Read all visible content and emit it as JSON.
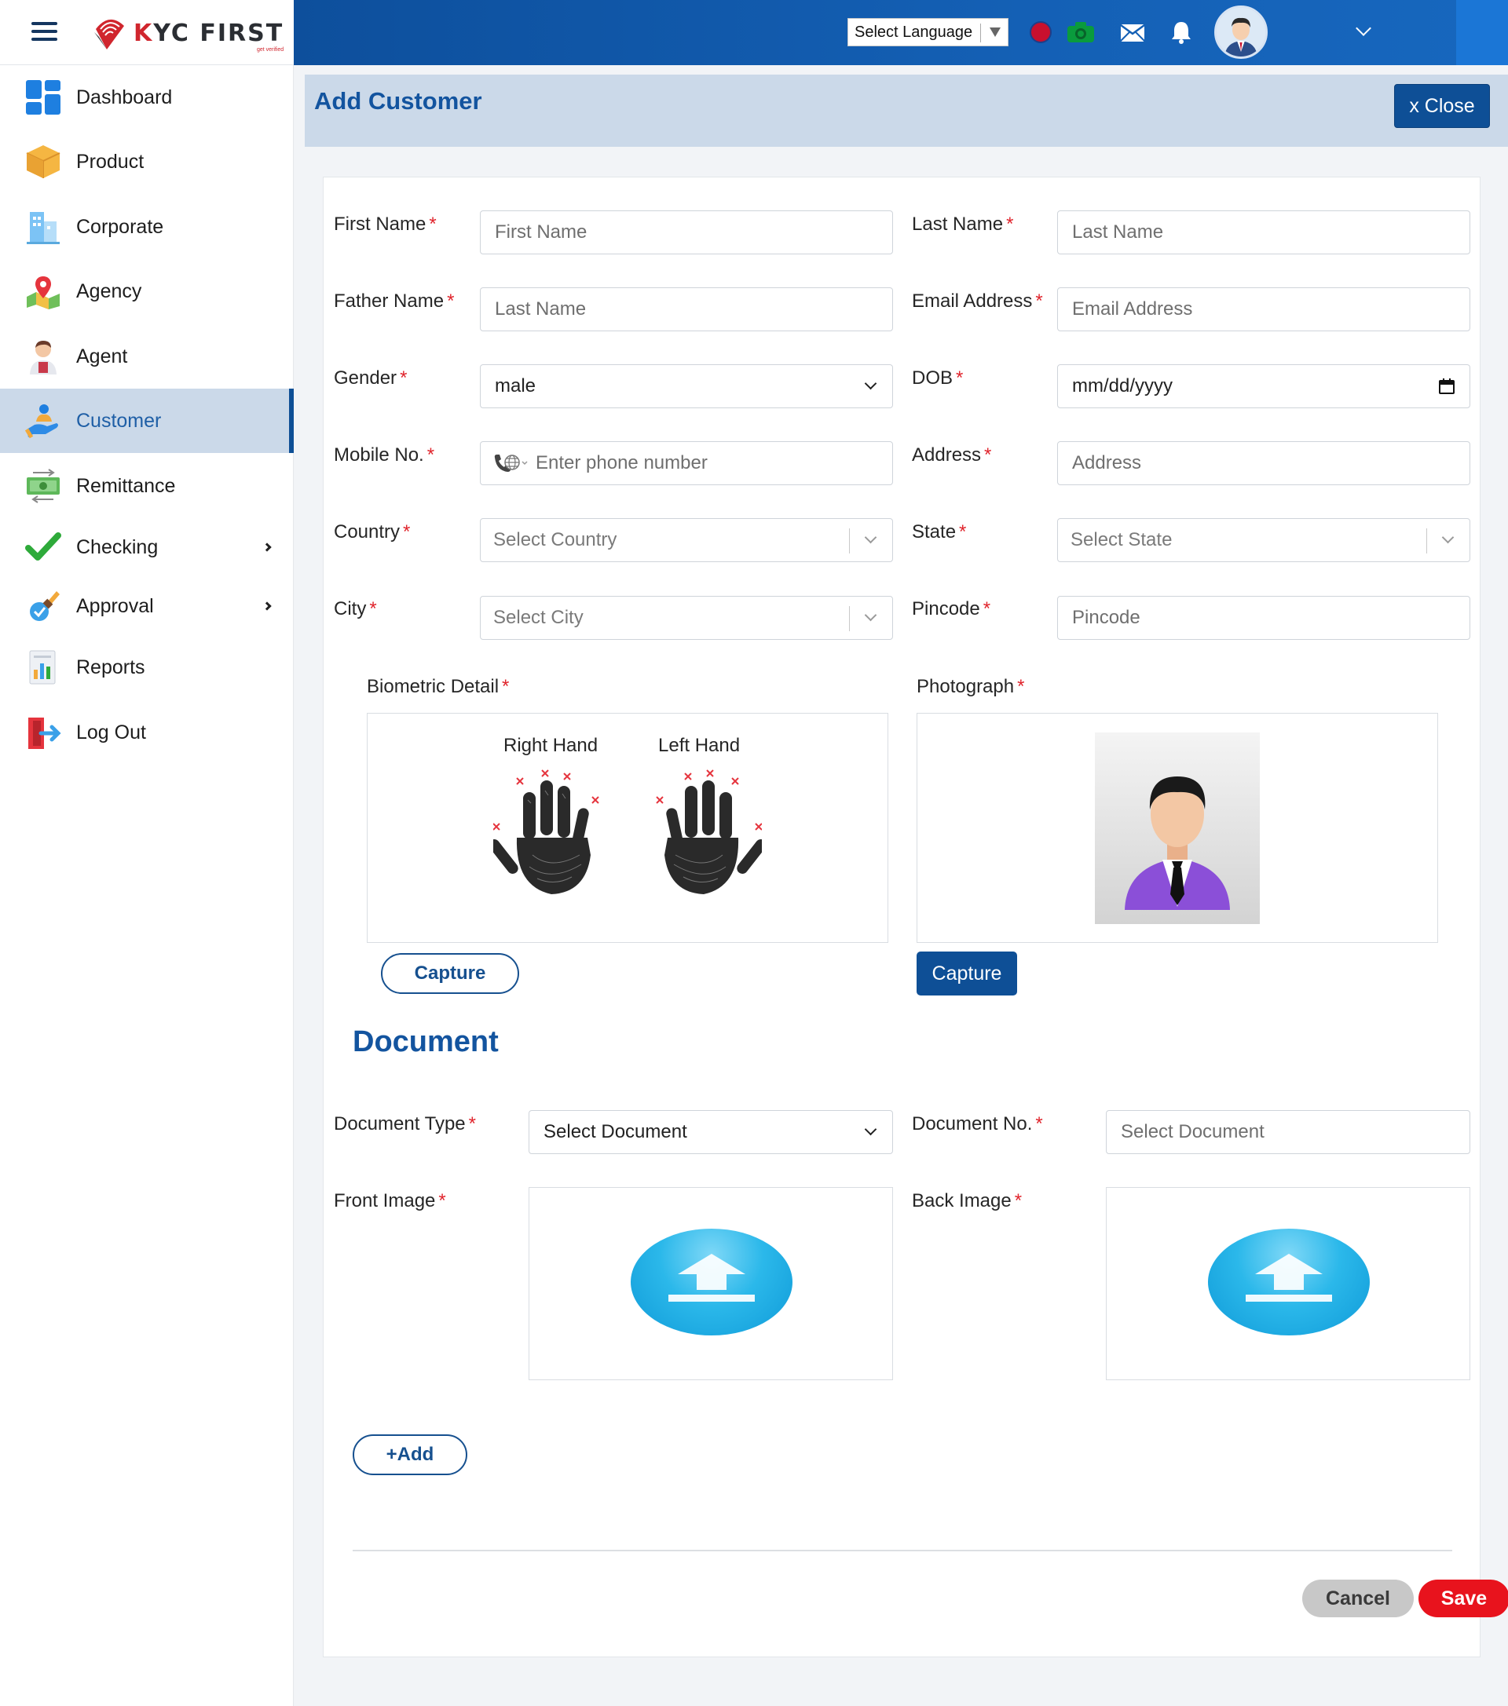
{
  "brand": {
    "name_prefix": "K",
    "name_rest": "YC FIRST",
    "tagline": "get verified"
  },
  "header": {
    "language_select": "Select Language",
    "colors": {
      "topbar": "#1460b5",
      "accent": "#0e4f96"
    }
  },
  "sidebar": {
    "items": [
      {
        "label": "Dashboard",
        "icon": "dashboard-icon"
      },
      {
        "label": "Product",
        "icon": "product-box-icon"
      },
      {
        "label": "Corporate",
        "icon": "corporate-building-icon"
      },
      {
        "label": "Agency",
        "icon": "agency-map-icon"
      },
      {
        "label": "Agent",
        "icon": "agent-person-icon"
      },
      {
        "label": "Customer",
        "icon": "customer-hand-icon",
        "active": true
      },
      {
        "label": "Remittance",
        "icon": "remittance-money-icon"
      },
      {
        "label": "Checking",
        "icon": "checkmark-icon",
        "submenu": true
      },
      {
        "label": "Approval",
        "icon": "approval-stamp-icon",
        "submenu": true
      },
      {
        "label": "Reports",
        "icon": "reports-chart-icon"
      },
      {
        "label": "Log Out",
        "icon": "logout-door-icon"
      }
    ]
  },
  "page": {
    "title": "Add Customer",
    "close_label": "x Close"
  },
  "form": {
    "first_name": {
      "label": "First Name",
      "placeholder": "First Name"
    },
    "last_name": {
      "label": "Last Name",
      "placeholder": "Last Name"
    },
    "father_name": {
      "label": "Father Name",
      "placeholder": "Last Name"
    },
    "email": {
      "label": "Email Address",
      "placeholder": "Email Address"
    },
    "gender": {
      "label": "Gender",
      "value": "male"
    },
    "dob": {
      "label": "DOB",
      "value": "mm/dd/yyyy"
    },
    "mobile": {
      "label": "Mobile No.",
      "placeholder": "Enter phone number"
    },
    "address": {
      "label": "Address",
      "placeholder": "Address"
    },
    "country": {
      "label": "Country",
      "placeholder": "Select Country"
    },
    "state": {
      "label": "State",
      "placeholder": "Select State"
    },
    "city": {
      "label": "City",
      "placeholder": "Select City"
    },
    "pincode": {
      "label": "Pincode",
      "placeholder": "Pincode"
    }
  },
  "biometric": {
    "label": "Biometric Detail",
    "right_hand": "Right Hand",
    "left_hand": "Left Hand",
    "capture_label": "Capture"
  },
  "photograph": {
    "label": "Photograph",
    "capture_label": "Capture"
  },
  "document": {
    "title": "Document",
    "type": {
      "label": "Document Type",
      "value": "Select Document"
    },
    "number": {
      "label": "Document No.",
      "placeholder": "Select Document"
    },
    "front_label": "Front Image",
    "back_label": "Back Image",
    "add_label": "+Add"
  },
  "actions": {
    "cancel": "Cancel",
    "save": "Save"
  }
}
